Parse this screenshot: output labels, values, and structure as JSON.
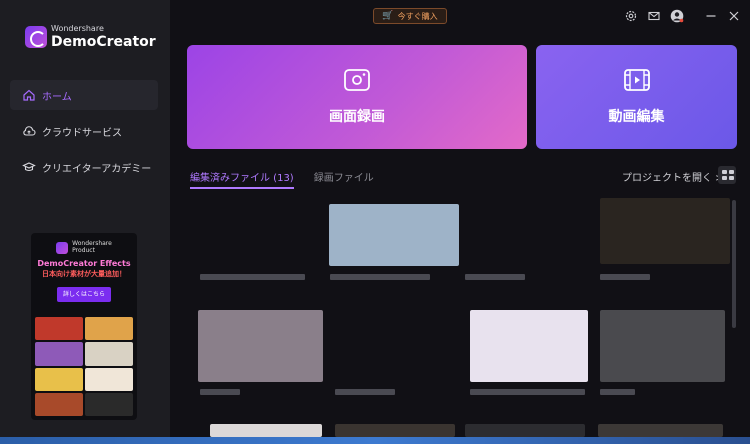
{
  "app": {
    "brand_small": "Wondershare",
    "brand_name": "DemoCreator"
  },
  "sidebar": {
    "items": [
      {
        "label": "ホーム",
        "icon": "home-icon",
        "active": true
      },
      {
        "label": "クラウドサービス",
        "icon": "cloud-icon",
        "active": false
      },
      {
        "label": "クリエイターアカデミー",
        "icon": "academy-icon",
        "active": false
      }
    ],
    "promo": {
      "brand_small": "Wondershare",
      "brand_line2": "Product",
      "title": "DemoCreator Effects",
      "subtitle": "日本向け素材が大量追加！",
      "button": "詳しくはこちら"
    }
  },
  "topbar": {
    "buy_label": "今すぐ購入"
  },
  "cards": {
    "record_label": "画面録画",
    "edit_label": "動画編集"
  },
  "tabs": {
    "edited_label": "編集済みファイル (13)",
    "recorded_label": "録画ファイル"
  },
  "open_project_label": "プロジェクトを開く >",
  "colors": {
    "accent": "#a66bff",
    "record_card": "#c25ad6",
    "edit_card": "#7a5ef0",
    "buy_text": "#f0a060"
  }
}
